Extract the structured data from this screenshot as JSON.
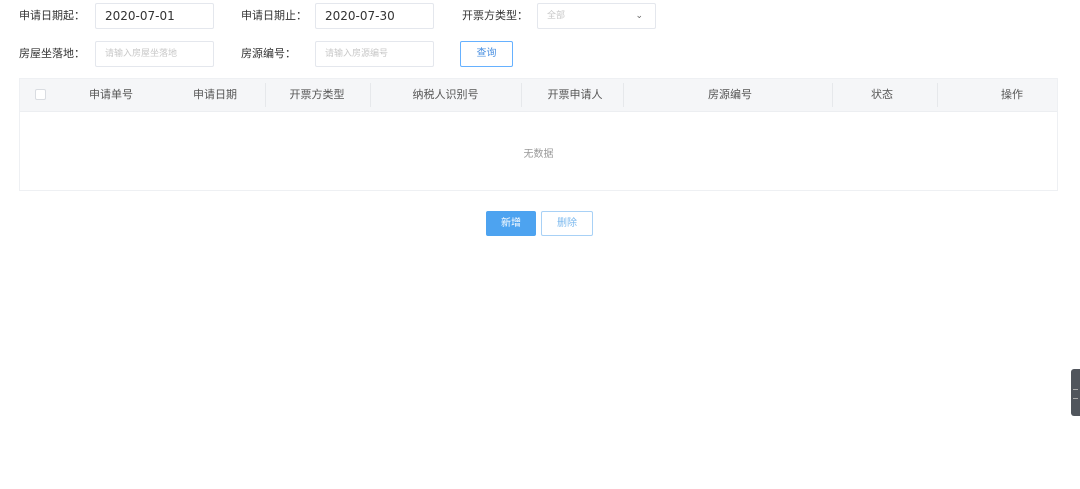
{
  "filters": {
    "start_date": {
      "label": "申请日期起：",
      "value": "2020-07-01"
    },
    "end_date": {
      "label": "申请日期止：",
      "value": "2020-07-30"
    },
    "issuer_type": {
      "label": "开票方类型：",
      "value": "全部"
    },
    "house_location": {
      "label": "房屋坐落地：",
      "placeholder": "请输入房屋坐落地"
    },
    "property_code": {
      "label": "房源编号：",
      "placeholder": "请输入房源编号"
    },
    "search_label": "查询"
  },
  "table": {
    "columns": [
      "申请单号",
      "申请日期",
      "开票方类型",
      "纳税人识别号",
      "开票申请人",
      "房源编号",
      "状态",
      "操作"
    ],
    "empty_text": "无数据"
  },
  "actions": {
    "add_label": "新增",
    "delete_label": "删除"
  }
}
